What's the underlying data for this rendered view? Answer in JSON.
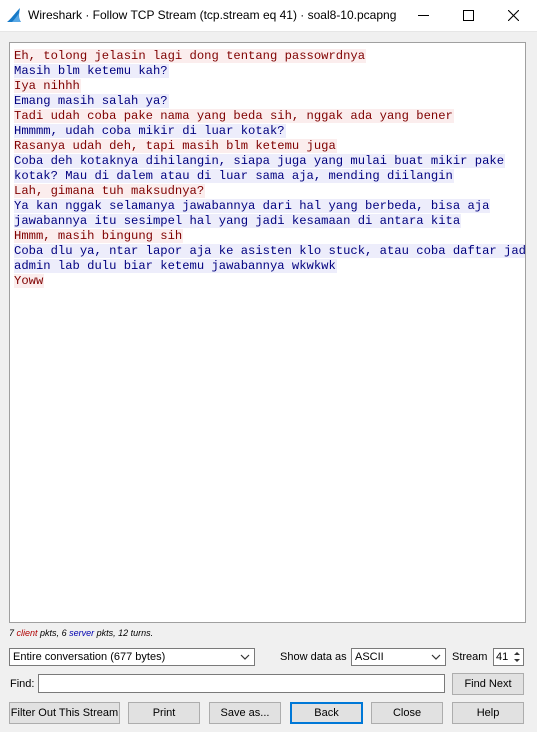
{
  "window": {
    "title": "Wireshark · Follow TCP Stream (tcp.stream eq 41) · soal8-10.pcapng"
  },
  "stream": {
    "lines": [
      {
        "side": "client",
        "text": "Eh, tolong jelasin lagi dong tentang passowrdnya"
      },
      {
        "side": "server",
        "text": "Masih blm ketemu kah?"
      },
      {
        "side": "client",
        "text": "Iya nihhh"
      },
      {
        "side": "server",
        "text": "Emang masih salah ya?"
      },
      {
        "side": "client",
        "text": "Tadi udah coba pake nama yang beda sih, nggak ada yang bener"
      },
      {
        "side": "server",
        "text": "Hmmmm, udah coba mikir di luar kotak?"
      },
      {
        "side": "client",
        "text": "Rasanya udah deh, tapi masih blm ketemu juga"
      },
      {
        "side": "server",
        "text": "Coba deh kotaknya dihilangin, siapa juga yang mulai buat mikir pake"
      },
      {
        "side": "server",
        "text": "kotak? Mau di dalem atau di luar sama aja, mending diilangin"
      },
      {
        "side": "client",
        "text": "Lah, gimana tuh maksudnya?"
      },
      {
        "side": "server",
        "text": "Ya kan nggak selamanya jawabannya dari hal yang berbeda, bisa aja"
      },
      {
        "side": "server",
        "text": "jawabannya itu sesimpel hal yang jadi kesamaan di antara kita"
      },
      {
        "side": "client",
        "text": "Hmmm, masih bingung sih"
      },
      {
        "side": "server",
        "text": "Coba dlu ya, ntar lapor aja ke asisten klo stuck, atau coba daftar jadi"
      },
      {
        "side": "server",
        "text": "admin lab dulu biar ketemu jawabannya wkwkwk"
      },
      {
        "side": "client",
        "text": "Yoww"
      }
    ],
    "colors": {
      "client_fg": "#7f0000",
      "client_bg": "#fbeded",
      "server_fg": "#00007f",
      "server_bg": "#ededfb"
    }
  },
  "stats": {
    "client_count": "7",
    "client_word": "client",
    "pkts_sep": " pkts, ",
    "server_count": "6",
    "server_word": "server",
    "tail": " pkts, 12 turns."
  },
  "controls": {
    "conversation_select": "Entire conversation (677 bytes)",
    "show_data_label": "Show data as",
    "show_data_select": "ASCII",
    "stream_label": "Stream",
    "stream_value": "41",
    "find_label": "Find:",
    "find_value": "",
    "find_next": "Find Next"
  },
  "buttons": {
    "filter_out": "Filter Out This Stream",
    "print": "Print",
    "save_as": "Save as...",
    "back": "Back",
    "close": "Close",
    "help": "Help"
  },
  "icons": {
    "app": "wireshark-fin-icon",
    "minimize": "minimize-icon",
    "maximize": "maximize-icon",
    "close": "close-icon"
  }
}
